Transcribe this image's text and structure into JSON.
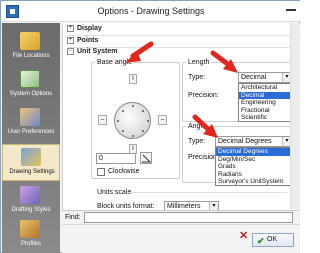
{
  "window": {
    "title": "Options - Drawing Settings"
  },
  "sidebar": {
    "items": [
      {
        "label": "File Locations",
        "icon": "folder-icon"
      },
      {
        "label": "System Options",
        "icon": "system-options-icon"
      },
      {
        "label": "User Preferences",
        "icon": "user-preferences-icon"
      },
      {
        "label": "Drawing Settings",
        "icon": "drawing-settings-icon",
        "active": true
      },
      {
        "label": "Drafting Styles",
        "icon": "drafting-styles-icon"
      },
      {
        "label": "Profiles",
        "icon": "profiles-icon"
      }
    ]
  },
  "tree": {
    "display": "Display",
    "points": "Points",
    "unit_system": "Unit System",
    "expand_symbol": "+",
    "collapse_symbol": "-"
  },
  "base_angle": {
    "legend": "Base angle",
    "value": "0",
    "clockwise_label": "Clockwise",
    "clockwise_checked": false
  },
  "length": {
    "legend": "Length",
    "type_label": "Type:",
    "type_value": "Decimal",
    "precision_label": "Precision:",
    "options": [
      "Architectural",
      "Decimal",
      "Engineering",
      "Fractional",
      "Scientific"
    ],
    "selected_index": 1
  },
  "angle": {
    "legend": "Angle",
    "type_label": "Type:",
    "type_value": "Decimal Degrees",
    "precision_label": "Precision:",
    "options": [
      "Decimal Degrees",
      "Deg/Min/Sec",
      "Grads",
      "Radians",
      "Surveyor's UnitSystem"
    ],
    "selected_index": 0
  },
  "units_scale": {
    "legend": "Units scale",
    "block_units_label": "Block units format:",
    "block_units_value": "Millimeters"
  },
  "find": {
    "label": "Find:",
    "value": ""
  },
  "buttons": {
    "ok": "OK"
  },
  "colors": {
    "accent_red": "#e0261d",
    "selection_blue": "#2b6bd6",
    "active_bg": "#f1e9c9"
  }
}
